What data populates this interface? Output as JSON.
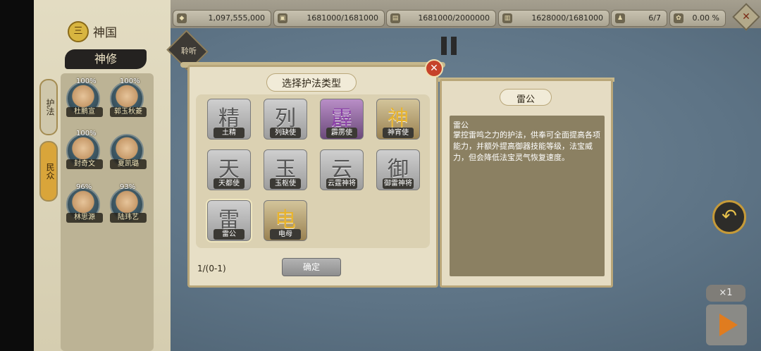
{
  "topbar": {
    "resources": [
      {
        "icon": "copper-icon",
        "glyph": "◆",
        "value": "1,097,555,000"
      },
      {
        "icon": "grain-icon",
        "glyph": "▣",
        "value": "1681000/1681000"
      },
      {
        "icon": "wood-icon",
        "glyph": "▤",
        "value": "1681000/2000000"
      },
      {
        "icon": "stone-icon",
        "glyph": "▥",
        "value": "1628000/1681000"
      },
      {
        "icon": "population-icon",
        "glyph": "♟",
        "value": "6/7"
      },
      {
        "icon": "rate-icon",
        "glyph": "✿",
        "value": "0.00 %"
      }
    ],
    "corner_button": "✕"
  },
  "left_panel": {
    "nation_icon": "三",
    "nation_name": "神国",
    "sect_banner": "神修",
    "tabs": [
      "护法",
      "民众"
    ],
    "heroes": [
      {
        "name": "杜鹏宣",
        "percent": "100%"
      },
      {
        "name": "郭玉秋菱",
        "percent": "100%"
      },
      {
        "name": "封奇文",
        "percent": "100%"
      },
      {
        "name": "夏凯璐",
        "percent": ""
      },
      {
        "name": "林思源",
        "percent": "96%"
      },
      {
        "name": "陆玮艺",
        "percent": "93%"
      }
    ]
  },
  "field": {
    "listen_label": "聆听",
    "return_symbol": "↶",
    "speed_label": "×1"
  },
  "dialog": {
    "title": "选择护法类型",
    "close_symbol": "✕",
    "cards": [
      {
        "glyph": "精",
        "label": "土精",
        "style": "grey"
      },
      {
        "glyph": "列",
        "label": "列缺使",
        "style": "grey"
      },
      {
        "glyph": "霹",
        "label": "霹雳使",
        "style": "purple"
      },
      {
        "glyph": "神",
        "label": "神宵使",
        "style": "gold"
      },
      {
        "glyph": "天",
        "label": "天都使",
        "style": "grey"
      },
      {
        "glyph": "玉",
        "label": "玉枢使",
        "style": "grey"
      },
      {
        "glyph": "云",
        "label": "云霆神将",
        "style": "grey"
      },
      {
        "glyph": "御",
        "label": "御雷神将",
        "style": "grey"
      },
      {
        "glyph": "雷",
        "label": "雷公",
        "style": "grey"
      },
      {
        "glyph": "电",
        "label": "电母",
        "style": "gold"
      }
    ],
    "count": "1/(0-1)",
    "confirm_label": "确定"
  },
  "info_panel": {
    "title": "雷公",
    "name": "雷公",
    "description": "掌控雷鸣之力的护法，供奉可全面提高各项能力，并额外提高御器技能等级，法宝威力，但会降低法宝灵气恢复速度。"
  }
}
